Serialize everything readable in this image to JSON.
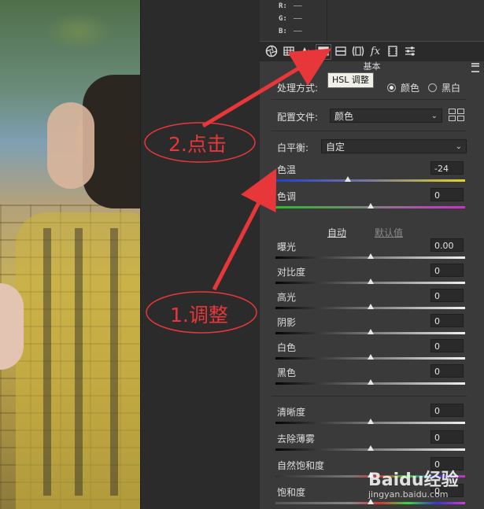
{
  "rgb_readout": {
    "r_label": "R:",
    "r_value": "——",
    "g_label": "G:",
    "g_value": "——",
    "b_label": "B:",
    "b_value": "——"
  },
  "toolbar": {
    "icons": [
      "aperture-icon",
      "grid-icon",
      "mountains-icon",
      "hsl-icon",
      "split-tone-icon",
      "lens-icon",
      "fx-icon",
      "calibration-icon",
      "presets-icon"
    ],
    "selected": "hsl-icon",
    "tooltip": "HSL 调整"
  },
  "section_title": "基本",
  "treatment": {
    "label": "处理方式:",
    "options": [
      {
        "label": "颜色",
        "selected": true
      },
      {
        "label": "黑白",
        "selected": false
      }
    ]
  },
  "profile": {
    "label": "配置文件:",
    "value": "颜色"
  },
  "white_balance": {
    "label": "白平衡:",
    "value": "自定"
  },
  "temp": {
    "label": "色温",
    "value": "-24",
    "level": 0.38
  },
  "tint": {
    "label": "色调",
    "value": "0",
    "level": 0.5
  },
  "auto_link": "自动",
  "default_link": "默认值",
  "tone": [
    {
      "label": "曝光",
      "value": "0.00",
      "level": 0.5
    },
    {
      "label": "对比度",
      "value": "0",
      "level": 0.5
    },
    {
      "label": "高光",
      "value": "0",
      "level": 0.5
    },
    {
      "label": "阴影",
      "value": "0",
      "level": 0.5
    },
    {
      "label": "白色",
      "value": "0",
      "level": 0.5
    },
    {
      "label": "黑色",
      "value": "0",
      "level": 0.5
    }
  ],
  "presence": [
    {
      "label": "清晰度",
      "value": "0",
      "level": 0.5
    },
    {
      "label": "去除薄雾",
      "value": "0",
      "level": 0.5
    },
    {
      "label": "自然饱和度",
      "value": "0",
      "level": 0.5
    },
    {
      "label": "饱和度",
      "value": "0",
      "level": 0.5
    }
  ],
  "annotations": {
    "step1": "1.调整",
    "step2": "2.点击",
    "color": "#e8373a"
  },
  "watermark": {
    "brand": "Baidu经验",
    "url": "jingyan.baidu.com"
  }
}
